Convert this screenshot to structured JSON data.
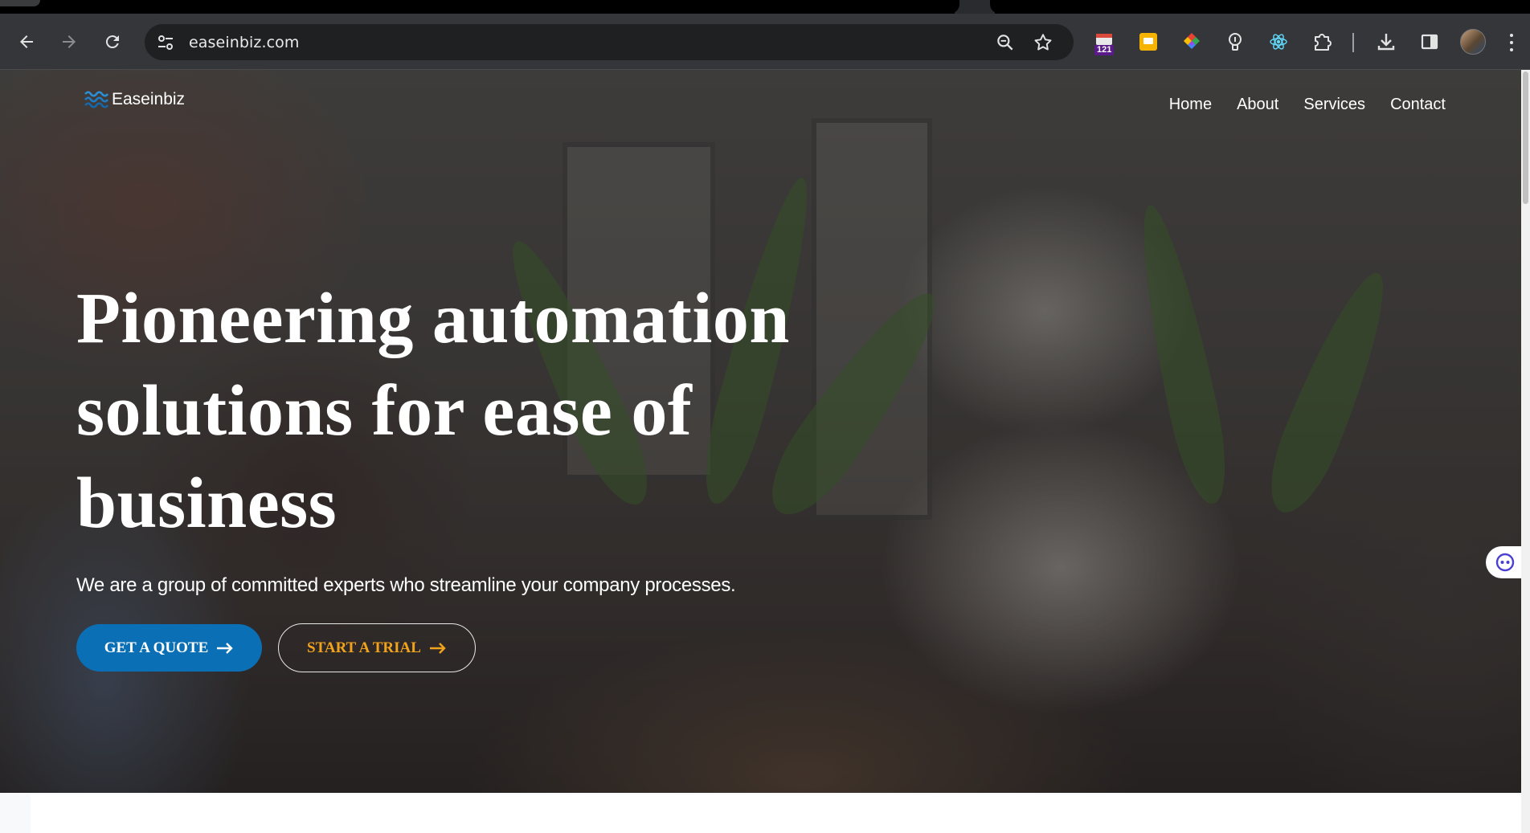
{
  "browser": {
    "url": "easeinbiz.com",
    "extensions": [
      {
        "name": "calendar-extension-icon",
        "badge": "121"
      },
      {
        "name": "sticky-note-extension-icon"
      },
      {
        "name": "color-picker-extension-icon"
      },
      {
        "name": "lightbulb-extension-icon"
      },
      {
        "name": "react-devtools-icon"
      },
      {
        "name": "extensions-puzzle-icon"
      }
    ]
  },
  "site": {
    "logo_text": "Easeinbiz",
    "nav": [
      "Home",
      "About",
      "Services",
      "Contact"
    ],
    "hero": {
      "title_lines": [
        "Pioneering automation",
        "solutions for ease of",
        "business"
      ],
      "subtitle": "We are a group of committed experts who streamline your company processes.",
      "primary_cta": "GET A QUOTE",
      "secondary_cta": "START A TRIAL"
    }
  },
  "colors": {
    "brand_blue": "#0a6fb5",
    "accent_orange": "#f2a31c",
    "chrome_toolbar": "#353639",
    "omnibox": "#1f2022"
  }
}
